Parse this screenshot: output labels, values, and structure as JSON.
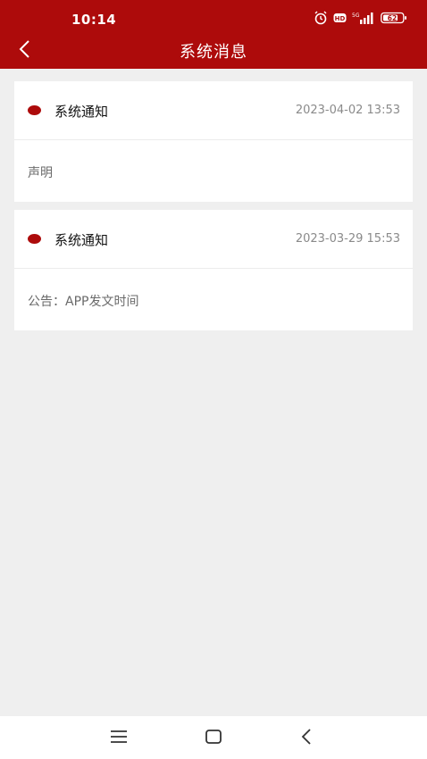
{
  "status": {
    "time": "10:14",
    "battery": "62",
    "network": "5G"
  },
  "header": {
    "title": "系统消息"
  },
  "messages": [
    {
      "title": "系统通知",
      "time": "2023-04-02 13:53",
      "content": "声明"
    },
    {
      "title": "系统通知",
      "time": "2023-03-29 15:53",
      "content": "公告：APP发文时间"
    }
  ],
  "colors": {
    "accent": "#ad0b0b",
    "background": "#efefef"
  },
  "icons": {
    "back": "chevron-left-icon",
    "menu": "menu-icon",
    "home": "home-icon",
    "nav_back": "back-icon"
  }
}
